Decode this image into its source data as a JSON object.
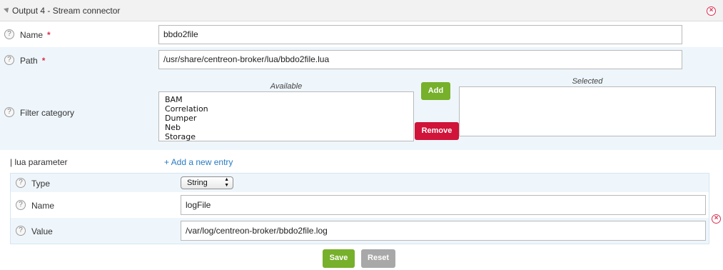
{
  "header": {
    "title": "Output 4 - Stream connector"
  },
  "fields": {
    "name": {
      "label": "Name",
      "required": "*",
      "value": "bbdo2file"
    },
    "path": {
      "label": "Path",
      "required": "*",
      "value": "/usr/share/centreon-broker/lua/bbdo2file.lua"
    },
    "filter": {
      "label": "Filter category",
      "available_caption": "Available",
      "selected_caption": "Selected",
      "available_items": [
        "BAM",
        "Correlation",
        "Dumper",
        "Neb",
        "Storage"
      ],
      "add_label": "Add",
      "remove_label": "Remove"
    }
  },
  "lua": {
    "label": "| lua parameter",
    "add_entry_label": "+ Add a new entry",
    "type": {
      "label": "Type",
      "value": "String"
    },
    "name": {
      "label": "Name",
      "value": "logFile"
    },
    "value": {
      "label": "Value",
      "value": "/var/log/centreon-broker/bbdo2file.log"
    }
  },
  "actions": {
    "save_label": "Save",
    "reset_label": "Reset"
  },
  "icons": {
    "help": "question-mark-circle",
    "close": "close-circle"
  },
  "colors": {
    "green": "#77b02b",
    "red": "#d0143a",
    "gray": "#a8a8a8",
    "link": "#2a7bc1",
    "close": "#d9304f"
  }
}
